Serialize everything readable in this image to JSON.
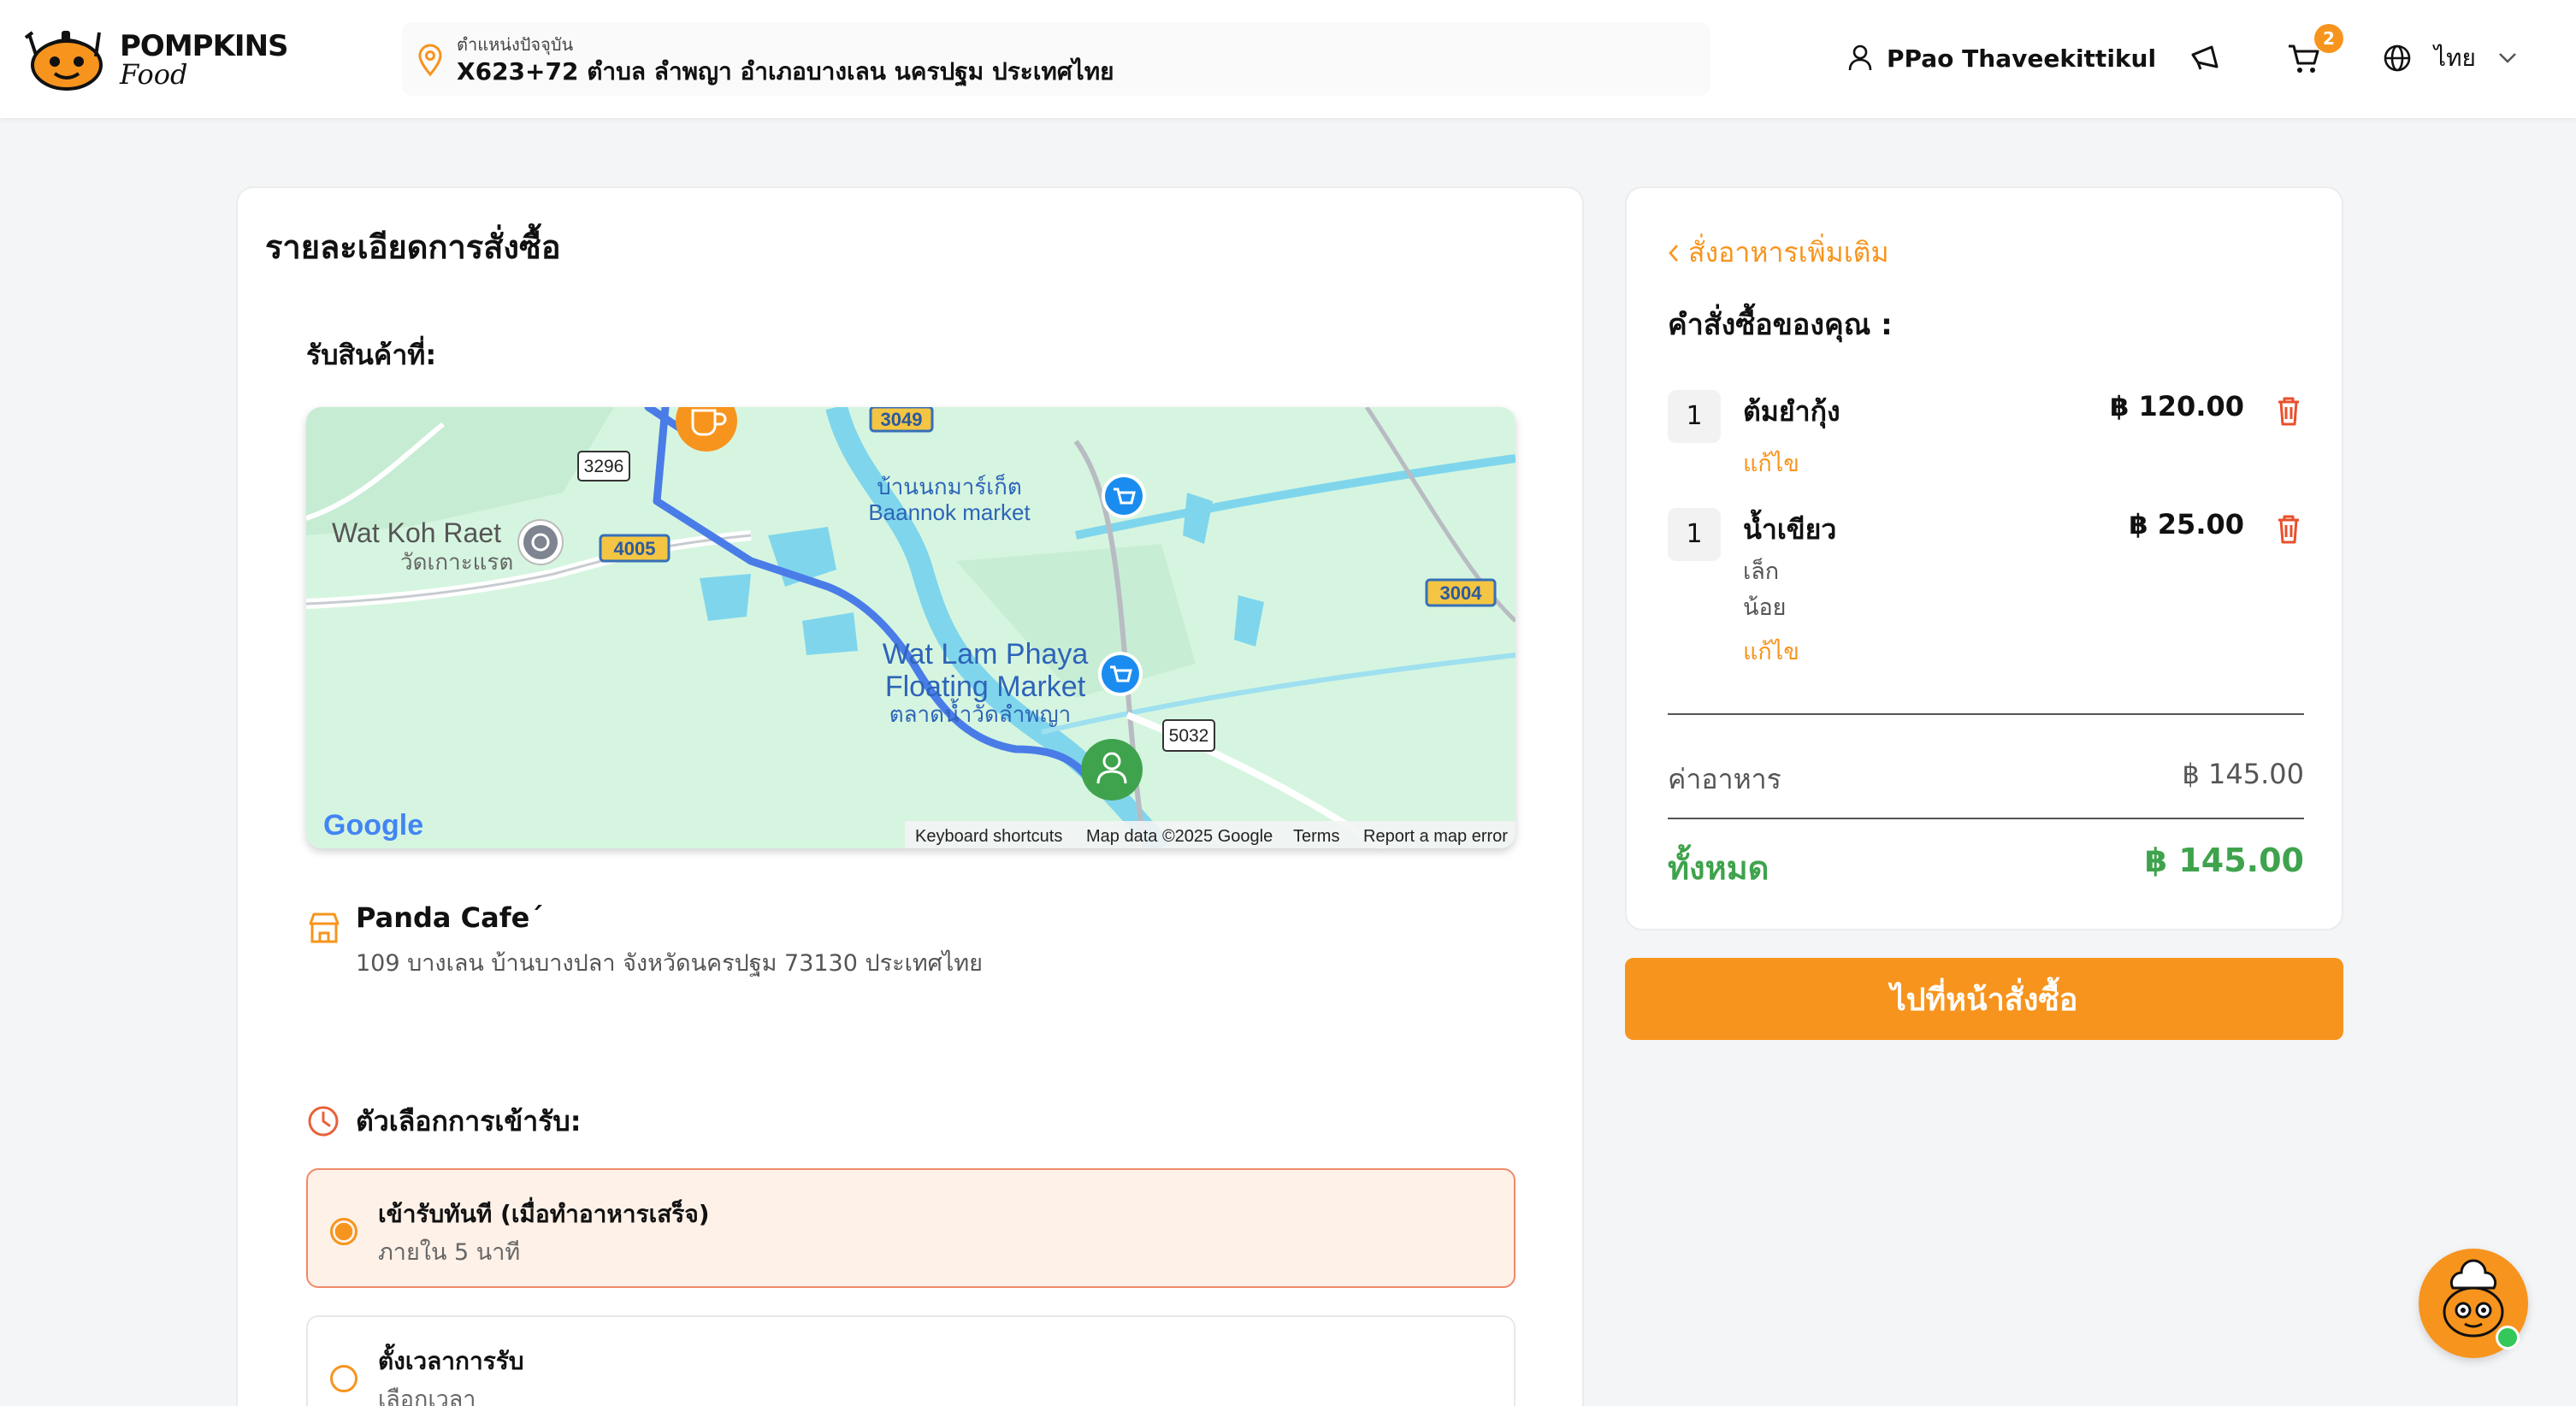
{
  "header": {
    "logo_line1": "POMPKINS",
    "logo_line2": "Food",
    "location_label": "ตำแหน่งปัจจุบัน",
    "location_address": "X623+72 ตำบล ลำพญา อำเภอบางเลน นครปฐม ประเทศไทย",
    "user_name": "PPao Thaveekittikul",
    "cart_count": "2",
    "language": "ไทย"
  },
  "order": {
    "title": "รายละเอียดการสั่งซื้อ",
    "pickup_label": "รับสินค้าที่:",
    "map": {
      "labels": {
        "wat_koh_raet": "Wat Koh Raet",
        "wat_koh_raet_th": "วัดเกาะแรต",
        "baannok_th": "บ้านนกมาร์เก็ต",
        "baannok_en": "Baannok market",
        "wat_lam_phaya_1": "Wat Lam Phaya",
        "wat_lam_phaya_2": "Floating Market",
        "wat_lam_phaya_th": "ตลาดน้ำวัดลำพญา",
        "road_3049": "3049",
        "road_3296": "3296",
        "road_4005": "4005",
        "road_3004": "3004",
        "road_5032": "5032",
        "google": "Google",
        "footer_shortcuts": "Keyboard shortcuts",
        "footer_data": "Map data ©2025 Google",
        "footer_terms": "Terms",
        "footer_report": "Report a map error"
      }
    },
    "store": {
      "name": "Panda Cafe´",
      "address": "109 บางเลน บ้านบางปลา จังหวัดนครปฐม 73130 ประเทศไทย"
    },
    "pickup_options_title": "ตัวเลือกการเข้ารับ:",
    "pickup_options": [
      {
        "title": "เข้ารับทันที (เมื่อทำอาหารเสร็จ)",
        "subtitle": "ภายใน 5 นาที",
        "selected": true
      },
      {
        "title": "ตั้งเวลาการรับ",
        "subtitle": "เลือกเวลา",
        "selected": false
      }
    ]
  },
  "cart": {
    "order_more": "สั่งอาหารเพิ่มเติม",
    "your_order": "คำสั่งซื้อของคุณ :",
    "items": [
      {
        "qty": "1",
        "name": "ต้มยำกุ้ง",
        "price": "฿ 120.00",
        "options": [],
        "edit": "แก้ไข"
      },
      {
        "qty": "1",
        "name": "น้ำเขียว",
        "price": "฿ 25.00",
        "options": [
          "เล็ก",
          "น้อย"
        ],
        "edit": "แก้ไข"
      }
    ],
    "food_cost_label": "ค่าอาหาร",
    "food_cost_value": "฿ 145.00",
    "total_label": "ทั้งหมด",
    "total_value": "฿ 145.00",
    "checkout_button": "ไปที่หน้าสั่งซื้อ"
  },
  "colors": {
    "accent": "#f7941d",
    "total_green": "#3fa34d",
    "map_bg": "#d6f5e0",
    "route_blue": "#4a7ce8"
  }
}
